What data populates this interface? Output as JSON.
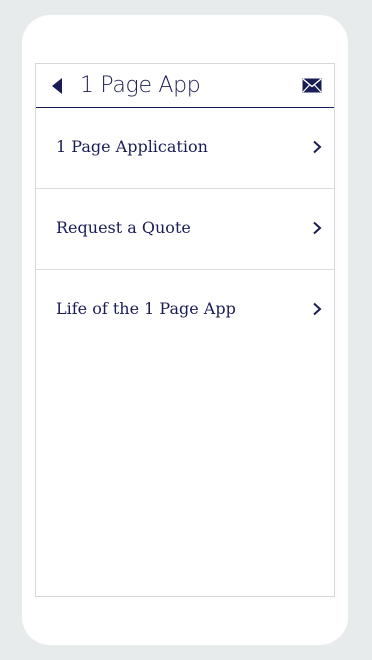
{
  "header": {
    "title": "1 Page App",
    "back_icon": "back-arrow-icon",
    "mail_icon": "envelope-icon"
  },
  "menu": {
    "items": [
      {
        "label": "1 Page Application"
      },
      {
        "label": "Request a Quote"
      },
      {
        "label": "Life of the 1 Page App"
      }
    ]
  },
  "colors": {
    "primary": "#1a1d55",
    "divider": "#d9dcdc",
    "background": "#e7ebeb",
    "surface": "#ffffff"
  }
}
